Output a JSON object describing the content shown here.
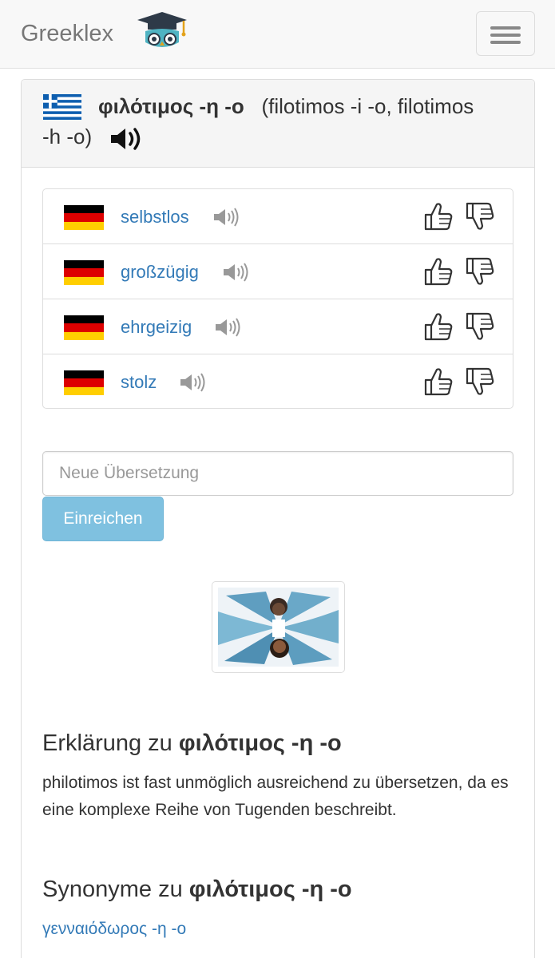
{
  "navbar": {
    "brand": "Greeklex",
    "logo_icon": "graduation-cap-owl-icon",
    "menu_icon": "hamburger-menu-icon"
  },
  "entry": {
    "flag_icon": "greece-flag-icon",
    "headword": "φιλότιμος -η -ο",
    "transliteration_line1": "(filotimos -i -o, filotimos",
    "transliteration_line2": "-h -o)",
    "speaker_icon": "speaker-icon"
  },
  "translations": [
    {
      "word": "selbstlos",
      "flag_icon": "germany-flag-icon"
    },
    {
      "word": "großzügig",
      "flag_icon": "germany-flag-icon"
    },
    {
      "word": "ehrgeizig",
      "flag_icon": "germany-flag-icon"
    },
    {
      "word": "stolz",
      "flag_icon": "germany-flag-icon"
    }
  ],
  "form": {
    "placeholder": "Neue Übersetzung",
    "submit_label": "Einreichen"
  },
  "explanation": {
    "heading_prefix": "Erklärung zu ",
    "heading_word": "φιλότιμος -η -ο",
    "text": "philotimos ist fast unmöglich ausreichend zu übersetzen, da es eine komplexe Reihe von Tugenden beschreibt."
  },
  "synonyms": {
    "heading_prefix": "Synonyme zu ",
    "heading_word": "φιλότιμος -η -ο",
    "items": [
      "γενναιόδωρος -η -ο"
    ]
  },
  "colors": {
    "link": "#337ab7",
    "button": "#7fc1e0",
    "navbar_bg": "#f8f8f8",
    "panel_heading_bg": "#f5f5f5"
  }
}
